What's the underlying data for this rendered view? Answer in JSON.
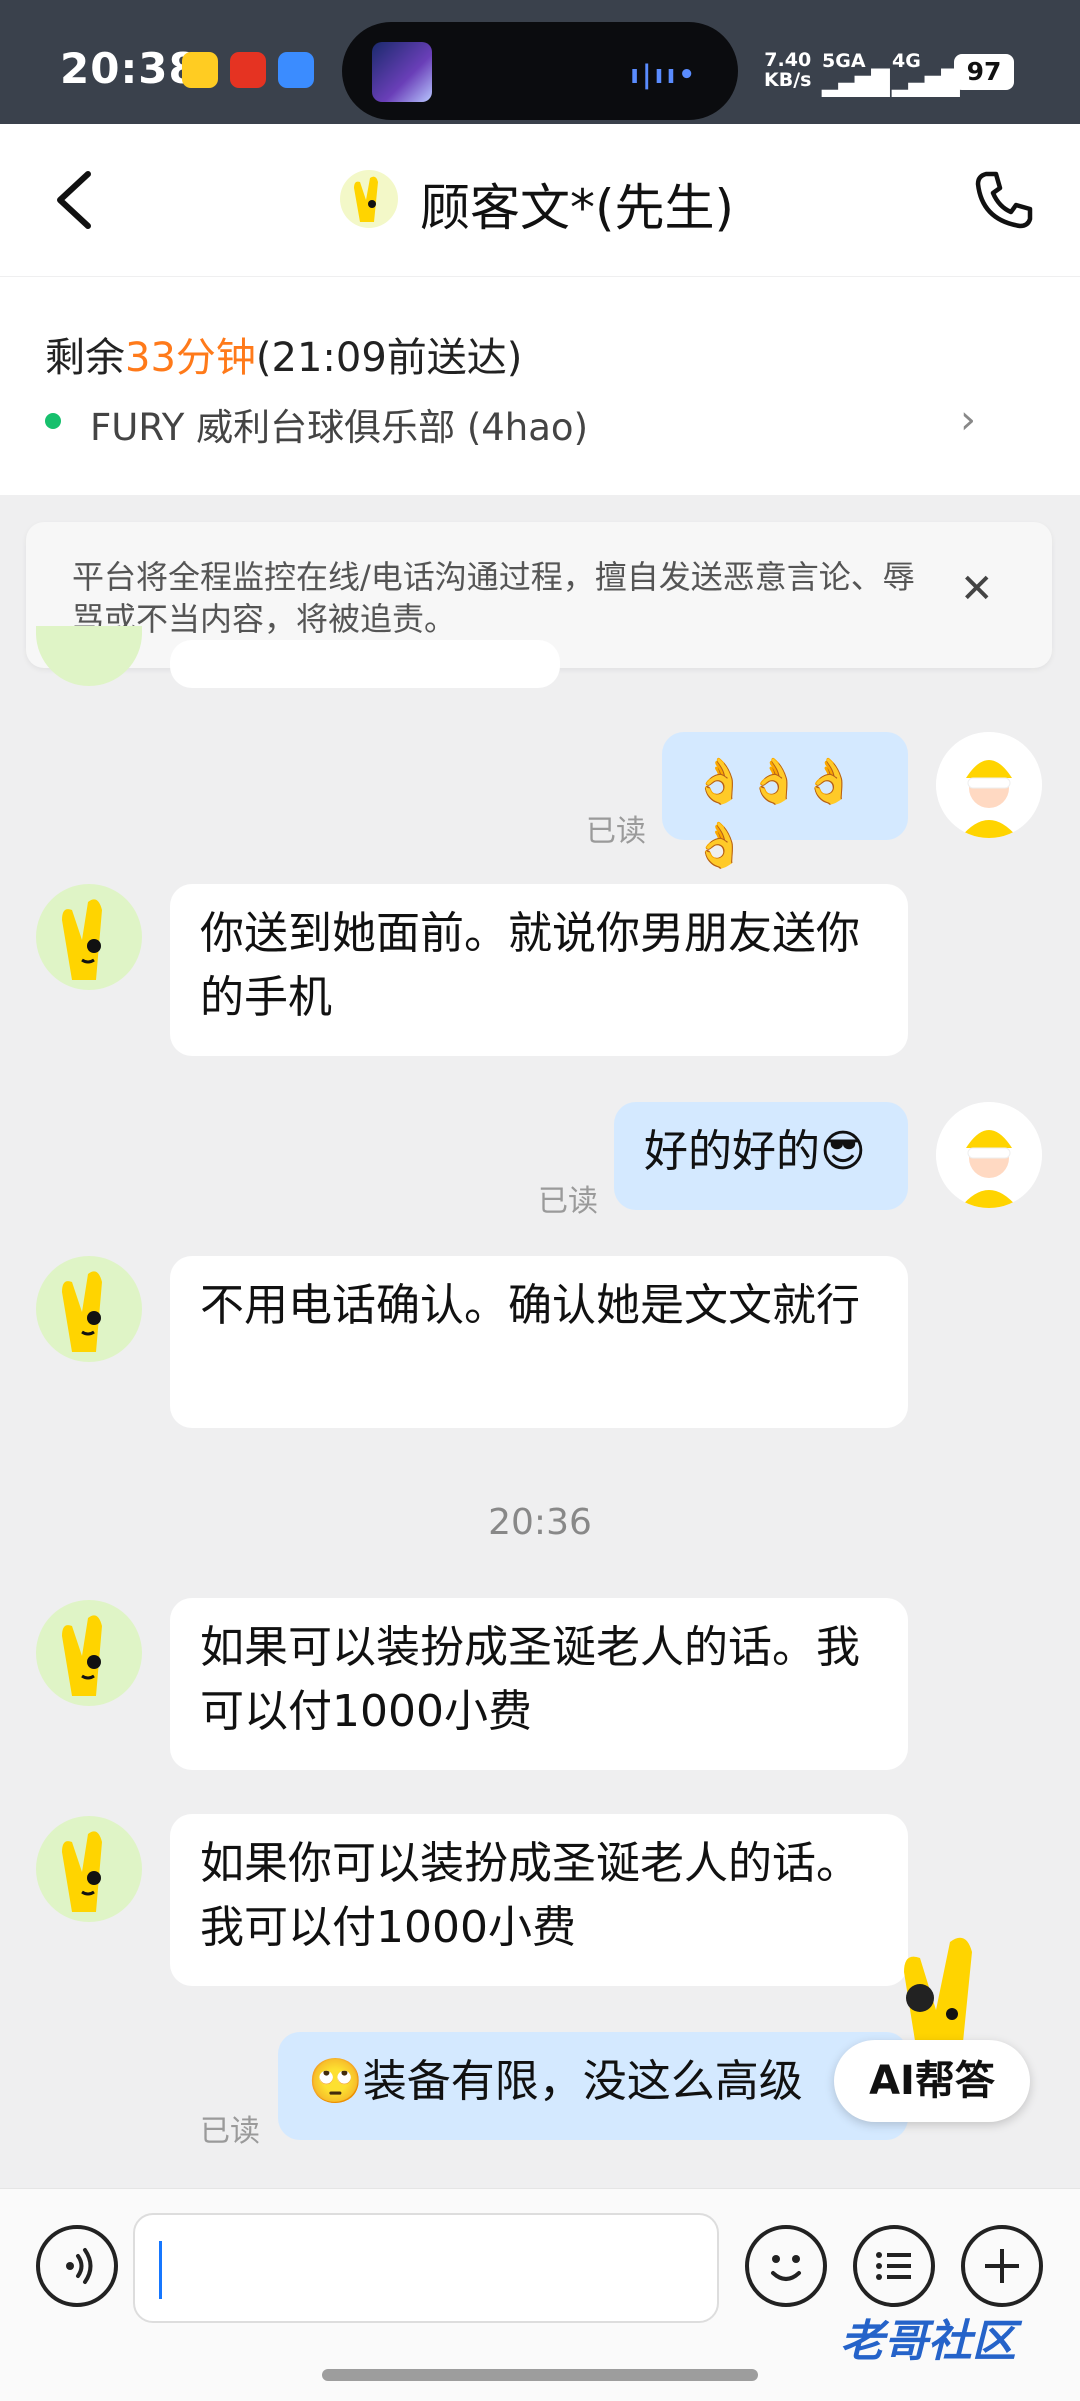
{
  "status_bar": {
    "time": "20:38",
    "net_speed_value": "7.40",
    "net_speed_unit": "KB/s",
    "signal1_label": "5GA",
    "signal2_label": "4G",
    "battery": "97"
  },
  "header": {
    "title": "顾客文*(先生)",
    "back_icon": "chevron-left-icon",
    "phone_icon": "phone-icon"
  },
  "order": {
    "eta_prefix": "剩余",
    "eta_minutes": "33分钟",
    "eta_suffix": "(21:09前送达)",
    "store_name": "FURY 威利台球俱乐部 (4hao)"
  },
  "notice": {
    "text": "平台将全程监控在线/电话沟通过程，擅自发送恶意言论、辱骂或不当内容，将被追责。"
  },
  "messages": [
    {
      "side": "out",
      "text": "👌👌👌👌",
      "read": "已读"
    },
    {
      "side": "in",
      "text": "你送到她面前。就说你男朋友送你的手机"
    },
    {
      "side": "out",
      "text": "好的好的😎",
      "read": "已读"
    },
    {
      "side": "in",
      "text": "不用电话确认。确认她是文文就行"
    },
    {
      "side": "in",
      "text": "如果可以装扮成圣诞老人的话。我可以付1000小费"
    },
    {
      "side": "in",
      "text": "如果你可以装扮成圣诞老人的话。我可以付1000小费"
    },
    {
      "side": "out",
      "text": "🙄装备有限，没这么高级",
      "read": "已读"
    }
  ],
  "timestamp": "20:36",
  "ai_button": "AI帮答",
  "watermark": "老哥社区",
  "colors": {
    "accent_orange": "#ff7a1a",
    "online_green": "#17c06d",
    "out_bubble": "#d4e9ff",
    "status_bar_bg": "#3a414c"
  }
}
